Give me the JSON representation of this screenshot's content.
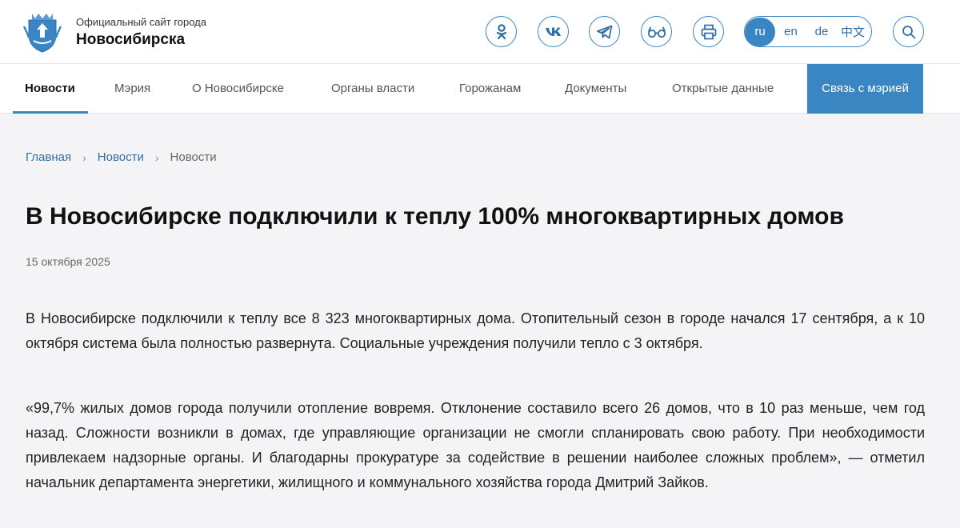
{
  "header": {
    "site_subtitle": "Официальный сайт города",
    "site_title": "Новосибирска",
    "logo_icon": "novosibirsk-coat-of-arms",
    "social_icons": [
      "odnoklassniki-icon",
      "vk-icon",
      "telegram-icon",
      "accessibility-glasses-icon",
      "print-icon"
    ],
    "languages": [
      "ru",
      "en",
      "de",
      "中文"
    ],
    "active_language": "ru",
    "search_icon": "search-icon"
  },
  "nav": {
    "items": [
      "Новости",
      "Мэрия",
      "О Новосибирске",
      "Органы власти",
      "Горожанам",
      "Документы",
      "Открытые данные"
    ],
    "active": "Новости",
    "cta": "Связь с мэрией"
  },
  "breadcrumbs": [
    "Главная",
    "Новости",
    "Новости"
  ],
  "article": {
    "title": "В Новосибирске подключили к теплу 100% многоквартирных домов",
    "date": "15 октября 2025",
    "paragraphs": [
      "В Новосибирске подключили к теплу все 8 323 многоквартирных дома. Отопительный сезон в городе начался 17 сентября, а к 10 октября система была полностью развернута. Социальные учреждения получили тепло с 3 октября.",
      "«99,7% жилых домов города получили отопление вовремя. Отклонение составило всего 26 домов, что в 10 раз меньше, чем год назад. Сложности возникли в домах, где управляющие организации не смогли спланировать свою работу. При необходимости привлекаем надзорные органы. И благодарны прокуратуре за содействие в решении наиболее сложных проблем», — отметил начальник департамента энергетики, жилищного и коммунального хозяйства города Дмитрий Зайков."
    ]
  },
  "colors": {
    "accent": "#3a86c3",
    "page_background": "#f4f4f6",
    "header_background": "#ffffff",
    "text": "#1a1a1a"
  }
}
